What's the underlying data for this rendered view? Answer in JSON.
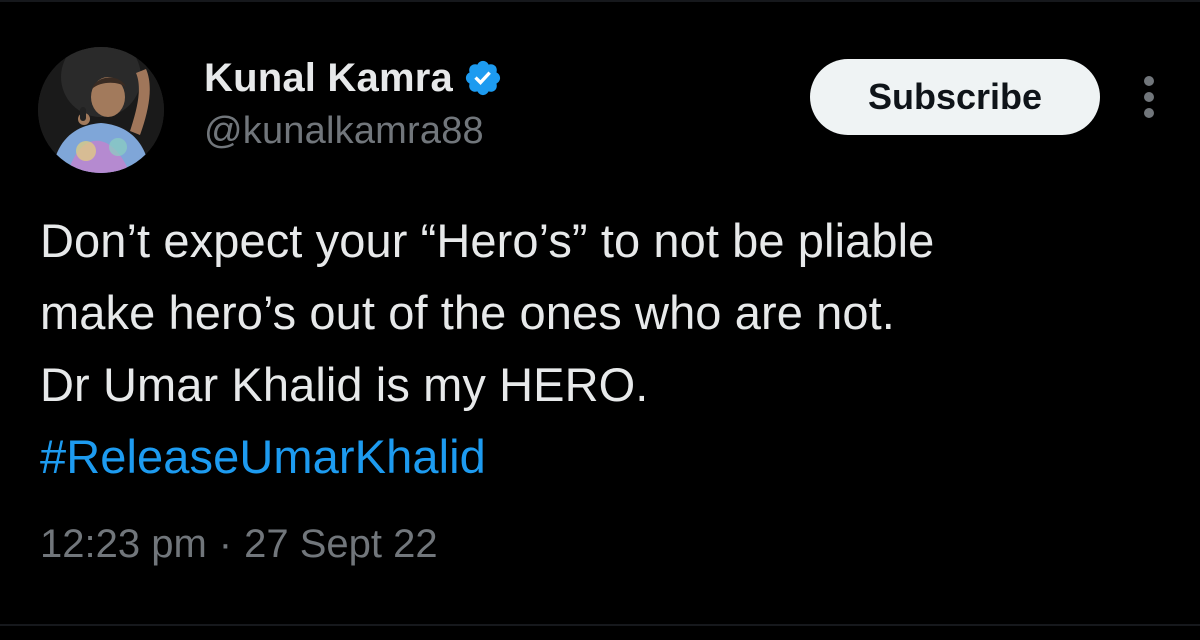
{
  "author": {
    "display_name": "Kunal Kamra",
    "handle": "@kunalkamra88",
    "verified_icon": "verified-badge-icon",
    "avatar": "profile-photo"
  },
  "actions": {
    "subscribe_label": "Subscribe",
    "more_icon": "more-vertical-icon"
  },
  "tweet": {
    "lines": [
      "Don’t expect your “Hero’s” to not be pliable",
      "make hero’s out of the ones who are not.",
      "Dr Umar Khalid is my HERO."
    ],
    "hashtag": "#ReleaseUmarKhalid"
  },
  "meta": {
    "time": "12:23 pm",
    "separator": "·",
    "date": "27 Sept 22"
  },
  "colors": {
    "background": "#000000",
    "text_primary": "#e7e9ea",
    "text_secondary": "#71767b",
    "accent": "#1d9bf0",
    "button_bg": "#eff3f4"
  }
}
